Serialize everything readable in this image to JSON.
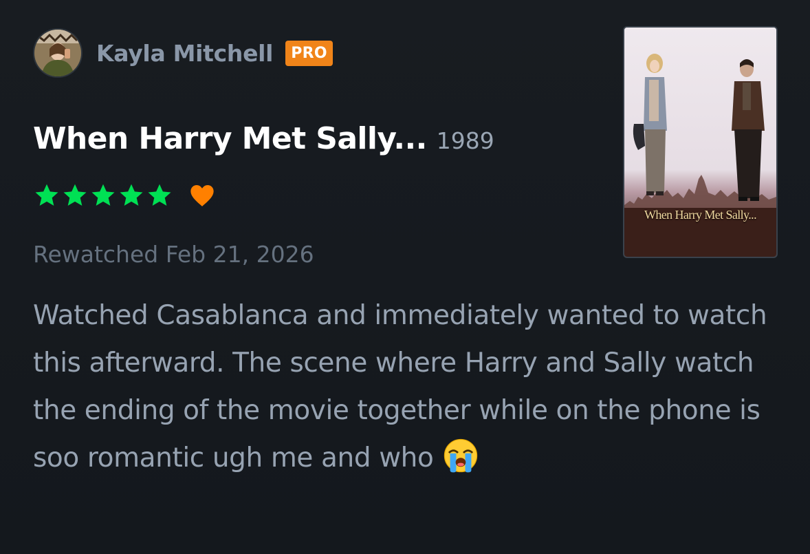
{
  "review": {
    "user": {
      "name": "Kayla Mitchell",
      "badge": "PRO"
    },
    "film": {
      "title": "When Harry Met Sally...",
      "year": "1989",
      "poster_title": "When Harry Met Sally..."
    },
    "rating": {
      "stars": 5,
      "max_stars": 5,
      "liked": true
    },
    "meta": "Rewatched Feb 21, 2026",
    "body": "Watched Casablanca and immediately wanted to watch this afterward. The scene where Harry and Sally watch the ending of the movie together while on the phone is soo romantic ugh me and who",
    "body_emoji": "loudly-crying-face-emoji"
  },
  "colors": {
    "background": "#15191e",
    "star_green": "#00e054",
    "heart_orange": "#ff8000",
    "pro_badge": "#f08419",
    "username": "#8a97a8",
    "body_text": "#97a3b2"
  },
  "icons": [
    "avatar",
    "star-icon",
    "heart-icon",
    "loudly-crying-face-emoji"
  ]
}
